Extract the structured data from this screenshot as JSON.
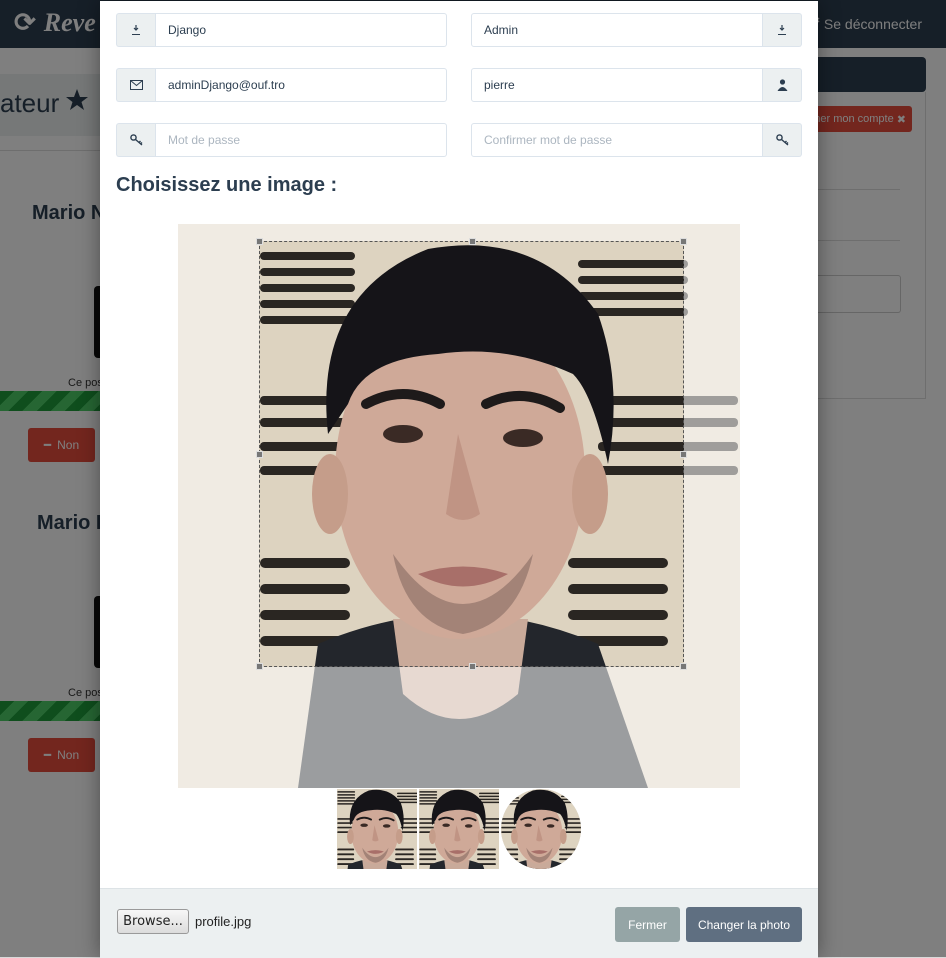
{
  "background": {
    "brand": "Reve",
    "logout": "Se déconnecter",
    "page_title": "ateur",
    "user1_name": "Mario N",
    "user2_name": "Mario I",
    "post_text_1": "Ce pos",
    "post_text_2": "Ce pos",
    "non_label_1": "Non",
    "non_label_2": "Non",
    "delete_account": "mer mon compte"
  },
  "form": {
    "first_name": "Django",
    "last_name": "Admin",
    "email": "adminDjango@ouf.tro",
    "username": "pierre",
    "password_placeholder": "Mot de passe",
    "confirm_placeholder": "Confirmer mot de passe"
  },
  "image_section": {
    "title": "Choisissez une image :"
  },
  "footer": {
    "browse_label": "Browse...",
    "file_name": "profile.jpg",
    "close_label": "Fermer",
    "change_label": "Changer la photo"
  },
  "icons": {
    "first_name": "user-outline-icon",
    "last_name": "user-outline-icon",
    "email": "envelope-icon",
    "username": "user-icon",
    "password": "key-icon",
    "confirm": "key-icon"
  },
  "colors": {
    "navbar": "#2c3e50",
    "danger": "#e74c3c",
    "success": "#1f9d3a",
    "primary_button": "#5f6f81",
    "secondary_button": "#95a5a6"
  }
}
